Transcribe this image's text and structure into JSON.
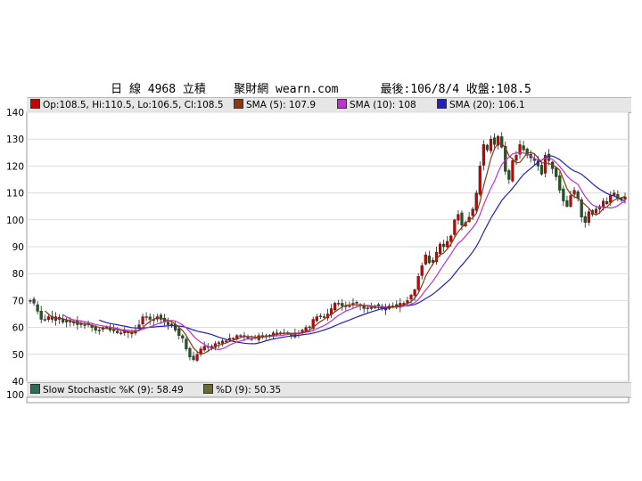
{
  "header": {
    "title": "日 線 4968 立積    聚財網 wearn.com      最後:106/8/4 收盤:108.5"
  },
  "legend_main": [
    {
      "label": "Op:108.5, Hi:110.5, Lo:106.5, Cl:108.5",
      "color": "#cc0000"
    },
    {
      "label": "SMA (5): 107.9",
      "color": "#8b3a0f"
    },
    {
      "label": "SMA (10): 108",
      "color": "#c030d0"
    },
    {
      "label": "SMA (20): 106.1",
      "color": "#2020c0"
    }
  ],
  "legend_sub": [
    {
      "label": "Slow Stochastic %K (9): 58.49",
      "color": "#2e6b5a"
    },
    {
      "label": "%D (9): 50.35",
      "color": "#6b6b2e"
    }
  ],
  "colors": {
    "up": "#cc0000",
    "down": "#1e5a1e",
    "sma5": "#8b3a0f",
    "sma10": "#c030d0",
    "sma20": "#2020c0",
    "grid": "#dcdcdc"
  },
  "chart_data": {
    "type": "candlestick",
    "ylim": [
      40,
      140
    ],
    "yticks": [
      40,
      50,
      60,
      70,
      80,
      90,
      100,
      110,
      120,
      130,
      140
    ],
    "sub_yticks": [
      100
    ],
    "grid": true,
    "last_bar": {
      "open": 108.5,
      "high": 110.5,
      "low": 106.5,
      "close": 108.5
    },
    "series": [
      {
        "name": "Close",
        "values": [
          70,
          69,
          66,
          63,
          63,
          64,
          63,
          64,
          63,
          62,
          62,
          62,
          62,
          61,
          61,
          61,
          61,
          60,
          59,
          59,
          60,
          60,
          59,
          59,
          58,
          58,
          59,
          58,
          58,
          59,
          61,
          64,
          64,
          63,
          63,
          64,
          63,
          62,
          61,
          61,
          59,
          57,
          56,
          52,
          49,
          48,
          50,
          52,
          53,
          53,
          53,
          54,
          54,
          55,
          55,
          56,
          56,
          57,
          57,
          57,
          56,
          56,
          56,
          57,
          57,
          57,
          57,
          58,
          58,
          58,
          58,
          58,
          57,
          58,
          58,
          59,
          60,
          60,
          63,
          64,
          64,
          64,
          65,
          67,
          69,
          69,
          68,
          68,
          68,
          69,
          69,
          68,
          67,
          67,
          67,
          68,
          68,
          67,
          67,
          68,
          68,
          68,
          69,
          69,
          70,
          72,
          74,
          79,
          83,
          87,
          84,
          85,
          88,
          91,
          90,
          92,
          94,
          100,
          102,
          98,
          99,
          101,
          104,
          110,
          120,
          128,
          126,
          130,
          128,
          131,
          127,
          118,
          115,
          122,
          124,
          128,
          126,
          124,
          123,
          122,
          120,
          117,
          124,
          122,
          119,
          116,
          111,
          107,
          105,
          109,
          111,
          108,
          101,
          99,
          103,
          102,
          104,
          105,
          107,
          106,
          109,
          110,
          108,
          108,
          108.5
        ]
      },
      {
        "name": "SMA (5)",
        "values": []
      },
      {
        "name": "SMA (10)",
        "values": []
      },
      {
        "name": "SMA (20)",
        "values": []
      }
    ]
  }
}
